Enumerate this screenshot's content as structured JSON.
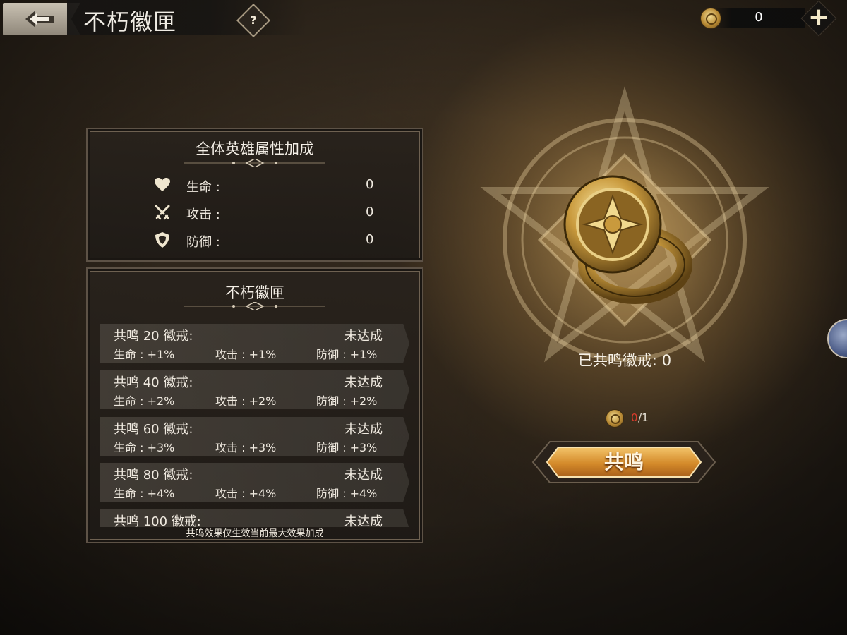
{
  "header": {
    "title": "不朽徽匣",
    "help_symbol": "?",
    "currency": {
      "icon": "ring-icon",
      "value": "0",
      "add_symbol": "+"
    }
  },
  "attribute_panel": {
    "title": "全体英雄属性加成",
    "stats": [
      {
        "icon": "heart-icon",
        "label": "生命 :",
        "value": "0"
      },
      {
        "icon": "crossed-swords-icon",
        "label": "攻击 :",
        "value": "0"
      },
      {
        "icon": "shield-icon",
        "label": "防御 :",
        "value": "0"
      }
    ]
  },
  "emblem_panel": {
    "title": "不朽徽匣",
    "tiers": [
      {
        "title": "共鸣 20 徽戒:",
        "status": "未达成",
        "hp": "生命 : +1%",
        "atk": "攻击 : +1%",
        "def": "防御 : +1%"
      },
      {
        "title": "共鸣 40 徽戒:",
        "status": "未达成",
        "hp": "生命 : +2%",
        "atk": "攻击 : +2%",
        "def": "防御 : +2%"
      },
      {
        "title": "共鸣 60 徽戒:",
        "status": "未达成",
        "hp": "生命 : +3%",
        "atk": "攻击 : +3%",
        "def": "防御 : +3%"
      },
      {
        "title": "共鸣 80 徽戒:",
        "status": "未达成",
        "hp": "生命 : +4%",
        "atk": "攻击 : +4%",
        "def": "防御 : +4%"
      },
      {
        "title": "共鸣 100 徽戒:",
        "status": "未达成",
        "hp": "",
        "atk": "",
        "def": ""
      }
    ],
    "footnote": "共鸣效果仅生效当前最大效果加成"
  },
  "resonance": {
    "resonated_text": "已共鸣徽戒: 0",
    "cost": {
      "icon": "ring-icon",
      "have": "0",
      "separator": "/",
      "need": "1"
    },
    "button_label": "共鸣"
  },
  "colors": {
    "accent_gold": "#d99a3a",
    "insufficient_red": "#d83b2b"
  }
}
